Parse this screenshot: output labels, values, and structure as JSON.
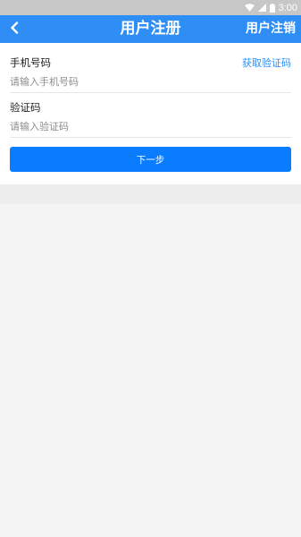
{
  "status_bar": {
    "time": "3:00",
    "icons": [
      "wifi-icon",
      "signal-icon",
      "battery-icon"
    ]
  },
  "app_bar": {
    "back_icon": "chevron-left-icon",
    "title": "用户注册",
    "action_label": "用户注销"
  },
  "form": {
    "phone": {
      "label": "手机号码",
      "placeholder": "请输入手机号码",
      "value": "",
      "get_code_label": "获取验证码"
    },
    "code": {
      "label": "验证码",
      "placeholder": "请输入验证码",
      "value": ""
    },
    "next_label": "下一步"
  },
  "colors": {
    "primary": "#2e8ef5",
    "button": "#0a7cff",
    "status_bar": "#c7c7c7",
    "background": "#f4f4f4"
  }
}
